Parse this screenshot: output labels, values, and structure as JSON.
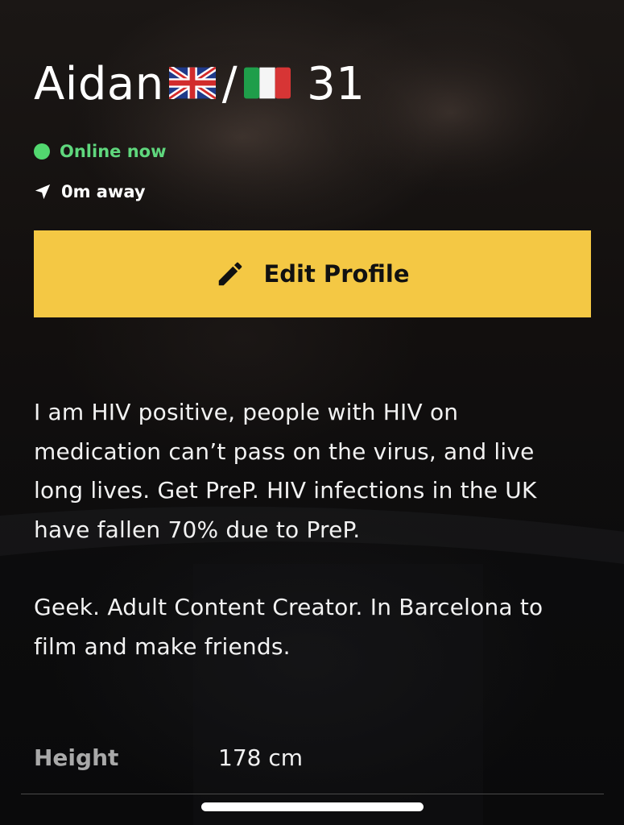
{
  "profile": {
    "name": "Aidan",
    "flags": [
      "uk-flag-icon",
      "italy-flag-icon"
    ],
    "separator": "/",
    "age": "31",
    "status_text": "Online now",
    "distance_text": "0m away"
  },
  "actions": {
    "edit_label": "Edit Profile",
    "edit_icon": "pencil-icon"
  },
  "bio": {
    "paragraph_1": "I am HIV positive, people with HIV on medication can’t pass on the virus, and live long lives. Get PreP. HIV infections in the UK have fallen 70% due to PreP.",
    "paragraph_2": "Geek. Adult Content Creator. In Barcelona to film and make friends."
  },
  "stats": [
    {
      "label": "Height",
      "value": "178 cm"
    }
  ],
  "colors": {
    "accent": "#f4c844",
    "online": "#52d86f",
    "label": "#a9a9a9"
  }
}
